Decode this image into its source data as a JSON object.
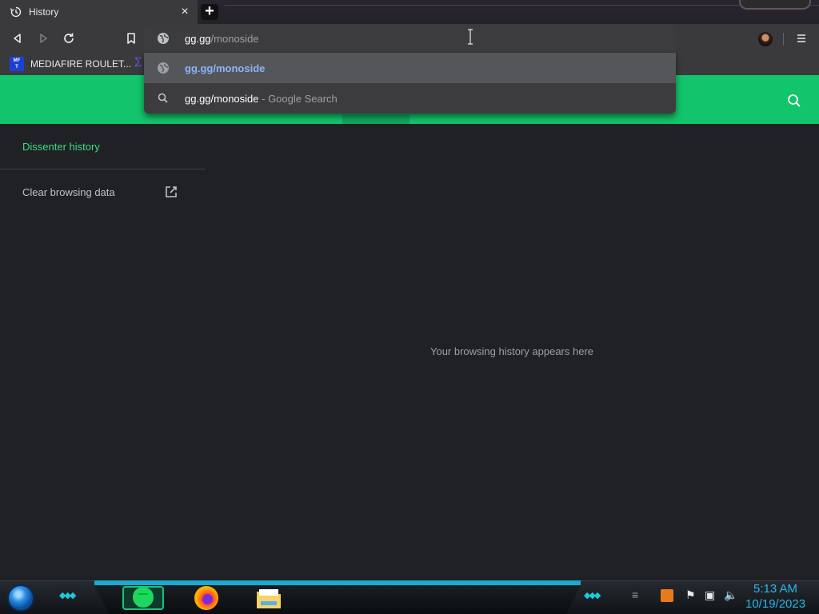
{
  "tab": {
    "title": "History",
    "favicon": "history-icon",
    "close": "×",
    "new_tab": "+"
  },
  "toolbar": {
    "back": "back-icon",
    "forward": "forward-icon",
    "reload": "reload-icon",
    "bookmark": "bookmark-icon",
    "menu": "menu-icon"
  },
  "omnibox": {
    "typed": "gg.gg",
    "autocomplete": "/monoside",
    "icon": "globe-icon"
  },
  "suggestions": [
    {
      "icon": "globe-icon",
      "text": "gg.gg/monoside",
      "selected": true
    },
    {
      "icon": "search-icon",
      "text": "gg.gg/monoside",
      "suffix": " - Google Search",
      "selected": false
    }
  ],
  "bookmarks": {
    "items": [
      {
        "label": "MEDIAFIRE ROULET...",
        "icon_text": "MF\nT"
      }
    ]
  },
  "sidebar": {
    "title": "Dissenter history",
    "clear_label": "Clear browsing data"
  },
  "main": {
    "empty_message": "Your browsing history appears here"
  },
  "taskbar": {
    "time": "5:13 AM",
    "date": "10/19/2023"
  },
  "colors": {
    "accent_green": "#12c46b",
    "link_green": "#3ddc84",
    "page_bg": "#202124",
    "suggestion_link": "#8ab4f8",
    "clock": "#27b7e8"
  }
}
